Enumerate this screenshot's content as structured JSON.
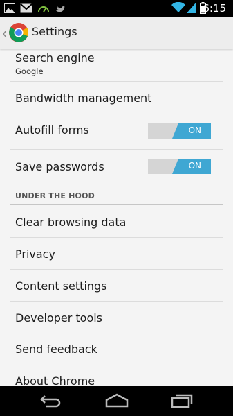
{
  "status_bar": {
    "time": "6:15",
    "icons": [
      "image-icon",
      "gmail-icon",
      "speed-icon",
      "twitter-icon",
      "wifi-icon",
      "signal-icon",
      "battery-icon"
    ]
  },
  "action_bar": {
    "title": "Settings",
    "app_icon": "chrome-icon"
  },
  "settings": {
    "search_engine": {
      "label": "Search engine",
      "value": "Google"
    },
    "bandwidth": {
      "label": "Bandwidth management"
    },
    "autofill": {
      "label": "Autofill forms",
      "toggle": "ON"
    },
    "save_passwords": {
      "label": "Save passwords",
      "toggle": "ON"
    }
  },
  "section": {
    "header": "UNDER THE HOOD"
  },
  "hood_items": {
    "clear_browsing": "Clear browsing data",
    "privacy": "Privacy",
    "content_settings": "Content settings",
    "developer_tools": "Developer tools",
    "send_feedback": "Send feedback",
    "about_chrome": "About Chrome"
  },
  "colors": {
    "toggle_on": "#3fa7d3",
    "toggle_track": "#d5d5d5",
    "background": "#f4f4f4"
  }
}
